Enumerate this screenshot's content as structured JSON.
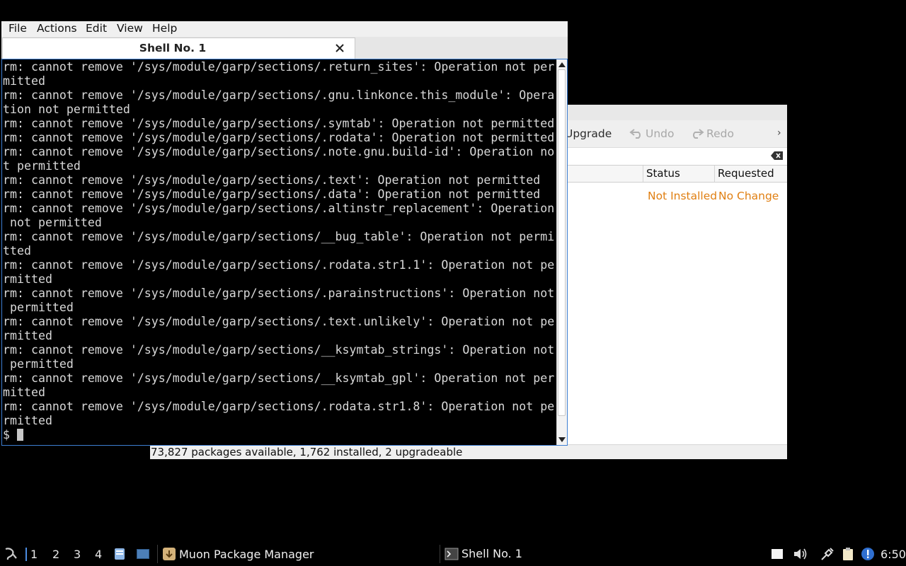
{
  "muon": {
    "toolbar": {
      "upgrade": "Upgrade",
      "undo": "Undo",
      "redo": "Redo",
      "more": "›"
    },
    "columns": {
      "status": "Status",
      "requested": "Requested"
    },
    "row": {
      "status": "Not Installed",
      "requested": "No Change"
    },
    "status_bar": "73,827 packages available, 1,762 installed, 2 upgradeable"
  },
  "terminal": {
    "menu": [
      "File",
      "Actions",
      "Edit",
      "View",
      "Help"
    ],
    "tab_title": "Shell No. 1",
    "lines": [
      "rm: cannot remove '/sys/module/garp/sections/.return_sites': Operation not per",
      "mitted",
      "rm: cannot remove '/sys/module/garp/sections/.gnu.linkonce.this_module': Opera",
      "tion not permitted",
      "rm: cannot remove '/sys/module/garp/sections/.symtab': Operation not permitted",
      "rm: cannot remove '/sys/module/garp/sections/.rodata': Operation not permitted",
      "rm: cannot remove '/sys/module/garp/sections/.note.gnu.build-id': Operation no",
      "t permitted",
      "rm: cannot remove '/sys/module/garp/sections/.text': Operation not permitted",
      "rm: cannot remove '/sys/module/garp/sections/.data': Operation not permitted",
      "rm: cannot remove '/sys/module/garp/sections/.altinstr_replacement': Operation",
      " not permitted",
      "rm: cannot remove '/sys/module/garp/sections/__bug_table': Operation not permi",
      "tted",
      "rm: cannot remove '/sys/module/garp/sections/.rodata.str1.1': Operation not pe",
      "rmitted",
      "rm: cannot remove '/sys/module/garp/sections/.parainstructions': Operation not",
      " permitted",
      "rm: cannot remove '/sys/module/garp/sections/.text.unlikely': Operation not pe",
      "rmitted",
      "rm: cannot remove '/sys/module/garp/sections/__ksymtab_strings': Operation not",
      " permitted",
      "rm: cannot remove '/sys/module/garp/sections/__ksymtab_gpl': Operation not per",
      "mitted",
      "rm: cannot remove '/sys/module/garp/sections/.rodata.str1.8': Operation not pe",
      "rmitted"
    ],
    "prompt": "$ "
  },
  "taskbar": {
    "workspaces": [
      "1",
      "2",
      "3",
      "4"
    ],
    "tasks": [
      {
        "label": "Muon Package Manager",
        "icon": "package-manager-icon"
      },
      {
        "label": "Shell No. 1",
        "icon": "terminal-icon"
      }
    ],
    "clock": "6:50"
  },
  "colors": {
    "accent": "#3d7ed1",
    "status_orange": "#e07f12"
  }
}
